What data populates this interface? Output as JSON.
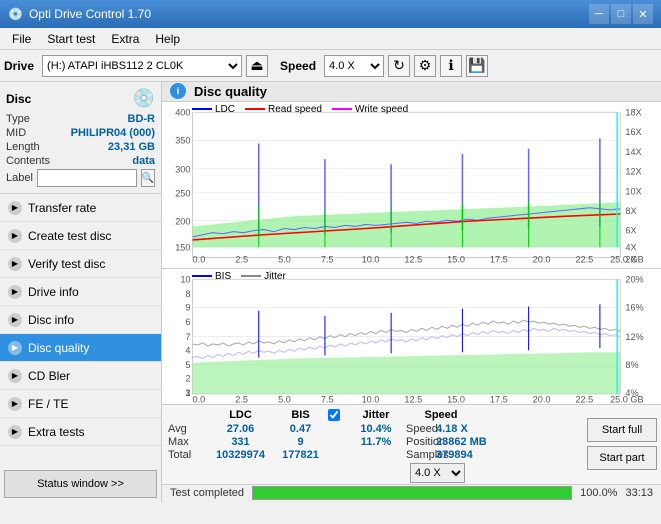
{
  "titleBar": {
    "title": "Opti Drive Control 1.70",
    "icon": "💿",
    "minimize": "─",
    "maximize": "□",
    "close": "✕"
  },
  "menuBar": {
    "items": [
      "File",
      "Start test",
      "Extra",
      "Help"
    ]
  },
  "toolbar": {
    "driveLabel": "Drive",
    "driveValue": "(H:) ATAPI iHBS112  2 CL0K",
    "speedLabel": "Speed",
    "speedValue": "4.0 X"
  },
  "sidebar": {
    "discTitle": "Disc",
    "discFields": [
      {
        "label": "Type",
        "value": "BD-R"
      },
      {
        "label": "MID",
        "value": "PHILIPR04 (000)"
      },
      {
        "label": "Length",
        "value": "23,31 GB"
      },
      {
        "label": "Contents",
        "value": "data"
      },
      {
        "label": "Label",
        "value": ""
      }
    ],
    "navItems": [
      {
        "label": "Transfer rate",
        "active": false
      },
      {
        "label": "Create test disc",
        "active": false
      },
      {
        "label": "Verify test disc",
        "active": false
      },
      {
        "label": "Drive info",
        "active": false
      },
      {
        "label": "Disc info",
        "active": false
      },
      {
        "label": "Disc quality",
        "active": true
      },
      {
        "label": "CD Bler",
        "active": false
      },
      {
        "label": "FE / TE",
        "active": false
      },
      {
        "label": "Extra tests",
        "active": false
      }
    ],
    "statusBtn": "Status window >>"
  },
  "chartArea": {
    "icon": "i",
    "title": "Disc quality",
    "legend1": [
      {
        "label": "LDC",
        "color": "#0000ff"
      },
      {
        "label": "Read speed",
        "color": "#ff0000"
      },
      {
        "label": "Write speed",
        "color": "#ff00ff"
      }
    ],
    "legend2": [
      {
        "label": "BIS",
        "color": "#0000ff"
      },
      {
        "label": "Jitter",
        "color": "#888888"
      }
    ],
    "yAxis1Max": 400,
    "yAxis1Right": [
      "18X",
      "16X",
      "14X",
      "12X",
      "10X",
      "8X",
      "6X",
      "4X",
      "2X"
    ],
    "yAxis2Max": 10,
    "yAxis2Right": [
      "20%",
      "16%",
      "12%",
      "8%",
      "4%"
    ]
  },
  "stats": {
    "headers": [
      "",
      "LDC",
      "BIS",
      "",
      "Jitter",
      "Speed",
      ""
    ],
    "rows": [
      {
        "label": "Avg",
        "ldc": "27.06",
        "bis": "0.47",
        "jitter": "10.4%",
        "speed": "4.18 X"
      },
      {
        "label": "Max",
        "ldc": "331",
        "bis": "9",
        "jitter": "11.7%",
        "position": "23862 MB"
      },
      {
        "label": "Total",
        "ldc": "10329974",
        "bis": "177821",
        "samples": "379894"
      }
    ],
    "jitterChecked": true,
    "speedDropdown": "4.0 X",
    "positionLabel": "Position",
    "positionValue": "23862 MB",
    "samplesLabel": "Samples",
    "samplesValue": "379894",
    "startFull": "Start full",
    "startPart": "Start part"
  },
  "statusBar": {
    "text": "Test completed",
    "progress": 100,
    "time": "33:13"
  }
}
